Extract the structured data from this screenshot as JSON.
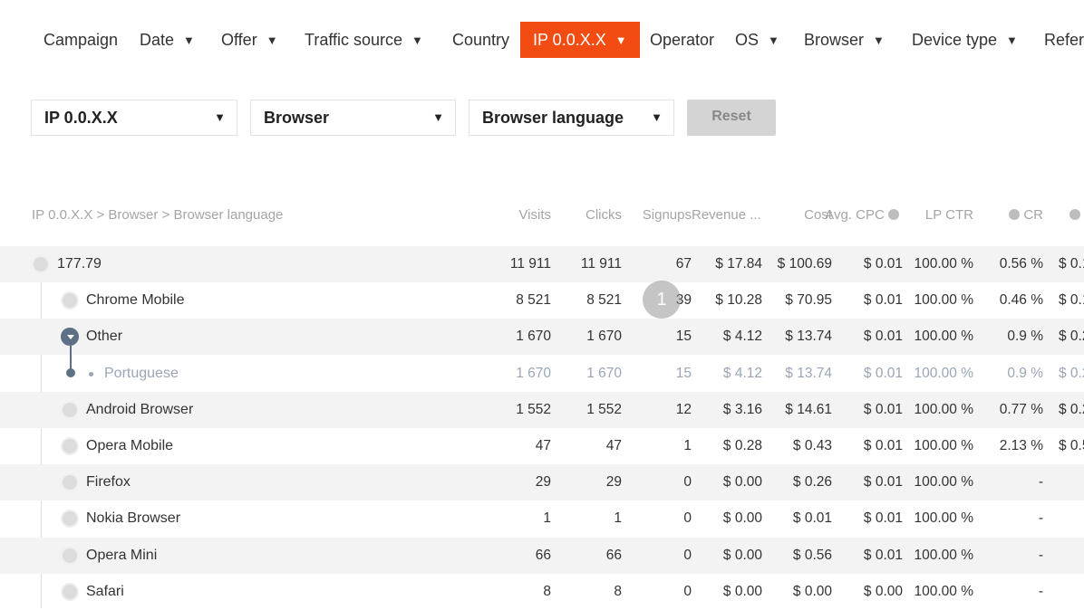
{
  "tabs": [
    {
      "label": "Campaign",
      "caret": false
    },
    {
      "label": "Date",
      "caret": true
    },
    {
      "label": "Offer",
      "caret": true
    },
    {
      "label": "Traffic source",
      "caret": true
    },
    {
      "label": "Country",
      "caret": false
    },
    {
      "label": "IP 0.0.X.X",
      "caret": true,
      "active": true
    },
    {
      "label": "Operator",
      "caret": false
    },
    {
      "label": "OS",
      "caret": true
    },
    {
      "label": "Browser",
      "caret": true
    },
    {
      "label": "Device type",
      "caret": true
    },
    {
      "label": "Refer",
      "caret": false
    }
  ],
  "groupings": {
    "select1": "IP 0.0.X.X",
    "select2": "Browser",
    "select3": "Browser language",
    "reset_label": "Reset"
  },
  "table": {
    "path_header": "IP 0.0.X.X > Browser > Browser language",
    "columns": [
      "Visits",
      "Clicks",
      "Signups",
      "Revenue ...",
      "Cost",
      "Avg. CPC",
      "LP CTR",
      "CR",
      "$"
    ],
    "rows": [
      {
        "name": "177.79",
        "level": 0,
        "open": false,
        "visits": "11 911",
        "clicks": "11 911",
        "signups": "67",
        "revenue": "$ 17.84",
        "cost": "$ 100.69",
        "cpc": "$ 0.01",
        "ctr": "100.00 %",
        "cr": "0.56 %",
        "epc": "$ 0.1"
      },
      {
        "name": "Chrome Mobile",
        "level": 1,
        "visits": "8 521",
        "clicks": "8 521",
        "signups": "39",
        "revenue": "$ 10.28",
        "cost": "$ 70.95",
        "cpc": "$ 0.01",
        "ctr": "100.00 %",
        "cr": "0.46 %",
        "epc": "$ 0.1"
      },
      {
        "name": "Other",
        "level": 1,
        "open": true,
        "visits": "1 670",
        "clicks": "1 670",
        "signups": "15",
        "revenue": "$ 4.12",
        "cost": "$ 13.74",
        "cpc": "$ 0.01",
        "ctr": "100.00 %",
        "cr": "0.9 %",
        "epc": "$ 0.2"
      },
      {
        "name": "Portuguese",
        "level": 2,
        "visits": "1 670",
        "clicks": "1 670",
        "signups": "15",
        "revenue": "$ 4.12",
        "cost": "$ 13.74",
        "cpc": "$ 0.01",
        "ctr": "100.00 %",
        "cr": "0.9 %",
        "epc": "$ 0.2"
      },
      {
        "name": "Android Browser",
        "level": 1,
        "visits": "1 552",
        "clicks": "1 552",
        "signups": "12",
        "revenue": "$ 3.16",
        "cost": "$ 14.61",
        "cpc": "$ 0.01",
        "ctr": "100.00 %",
        "cr": "0.77 %",
        "epc": "$ 0.2"
      },
      {
        "name": "Opera Mobile",
        "level": 1,
        "visits": "47",
        "clicks": "47",
        "signups": "1",
        "revenue": "$ 0.28",
        "cost": "$ 0.43",
        "cpc": "$ 0.01",
        "ctr": "100.00 %",
        "cr": "2.13 %",
        "epc": "$ 0.5"
      },
      {
        "name": "Firefox",
        "level": 1,
        "visits": "29",
        "clicks": "29",
        "signups": "0",
        "revenue": "$ 0.00",
        "cost": "$ 0.26",
        "cpc": "$ 0.01",
        "ctr": "100.00 %",
        "cr": "-",
        "epc": ""
      },
      {
        "name": "Nokia Browser",
        "level": 1,
        "visits": "1",
        "clicks": "1",
        "signups": "0",
        "revenue": "$ 0.00",
        "cost": "$ 0.01",
        "cpc": "$ 0.01",
        "ctr": "100.00 %",
        "cr": "-",
        "epc": ""
      },
      {
        "name": "Opera Mini",
        "level": 1,
        "visits": "66",
        "clicks": "66",
        "signups": "0",
        "revenue": "$ 0.00",
        "cost": "$ 0.56",
        "cpc": "$ 0.01",
        "ctr": "100.00 %",
        "cr": "-",
        "epc": ""
      },
      {
        "name": "Safari",
        "level": 1,
        "visits": "8",
        "clicks": "8",
        "signups": "0",
        "revenue": "$ 0.00",
        "cost": "$ 0.00",
        "cpc": "$ 0.00",
        "ctr": "100.00 %",
        "cr": "-",
        "epc": ""
      }
    ]
  },
  "cursor_badge": "1",
  "colors": {
    "accent": "#f24c13",
    "node_open": "#5e7086"
  }
}
